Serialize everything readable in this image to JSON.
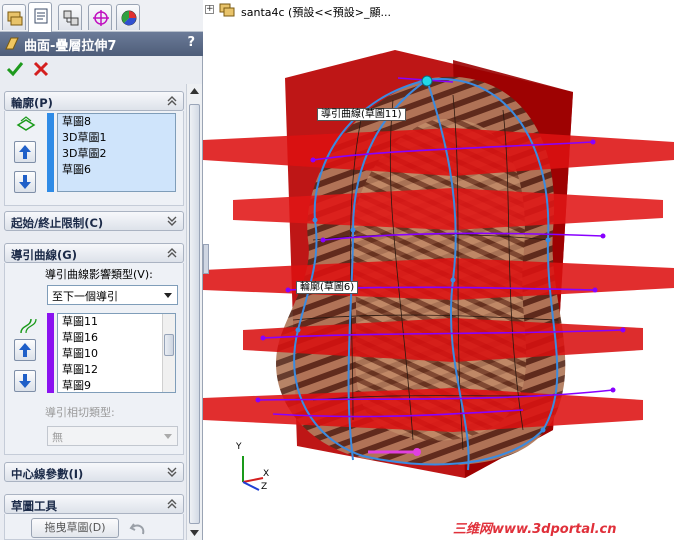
{
  "feature": {
    "title": "曲面-疊層拉伸7",
    "help": "?",
    "ok": "OK",
    "cancel": "Cancel"
  },
  "sections": {
    "profile": {
      "header": "輪廓(P)",
      "items": [
        "草圖8",
        "3D草圖1",
        "3D草圖2",
        "草圖6"
      ]
    },
    "start_end": {
      "header": "起始/終止限制(C)"
    },
    "guides": {
      "header": "導引曲線(G)",
      "influence_label": "導引曲線影響類型(V):",
      "influence_value": "至下一個導引",
      "items": [
        "草圖11",
        "草圖16",
        "草圖10",
        "草圖12",
        "草圖9"
      ],
      "tangency_label": "導引相切類型:",
      "tangency_value": "無"
    },
    "centerline": {
      "header": "中心線參數(I)"
    },
    "sketch_tools": {
      "header": "草圖工具",
      "drag_button": "拖曳草圖(D)"
    }
  },
  "viewport": {
    "tree_text": "santa4c (預設<<預設>_顯...",
    "label_guide": "導引曲線(草圖11)",
    "label_profile": "輪廓(草圖6)",
    "axis_y": "Y",
    "axis_x": "X",
    "axis_z": "Z"
  },
  "watermark": "三维网www.3dportal.cn",
  "colors": {
    "plane_red": "#dd1111",
    "guide_purple": "#8800ff",
    "profile_blue": "#3b8be0",
    "surface_brown": "#9a5a3c"
  }
}
